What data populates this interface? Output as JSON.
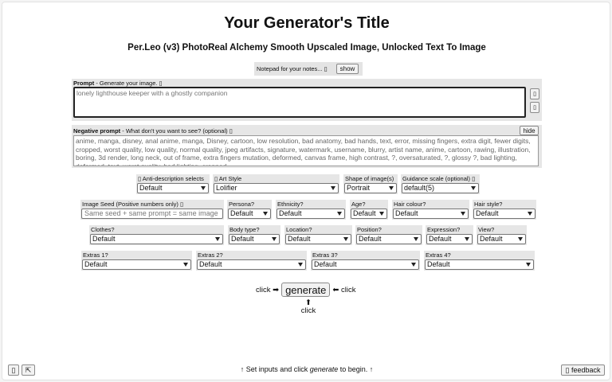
{
  "header": {
    "title": "Your Generator's Title",
    "subtitle": "Per.Leo (v3) PhotoReal Alchemy Smooth Upscaled Image, Unlocked Text To Image"
  },
  "notepad": {
    "label": "Notepad for your notes... ▯",
    "button": "show"
  },
  "prompt": {
    "label_bold": "Prompt",
    "label_rest": " - Generate your image. ▯",
    "placeholder": "lonely lighthouse keeper with a ghostly companion",
    "side_button_1": "▯",
    "side_button_2": "▯"
  },
  "negative_prompt": {
    "label_bold": "Negative prompt",
    "label_rest": " - What don't you want to see? (optional) ▯",
    "hide_button": "hide",
    "value": "anime, manga, disney, anal anime, manga, Disney, cartoon, low resolution, bad anatomy, bad hands, text, error, missing fingers, extra digit, fewer digits, cropped, worst quality, low quality, normal quality, jpeg artifacts, signature, watermark, username, blurry, artist name, anime, cartoon, rawing, illustration, boring, 3d render, long neck, out of frame, extra fingers mutation, deformed, canvas frame, high contrast, ?, oversaturated, ?, glossy ?, bad lighting, deformed, text, worst quality, bad lighting, cropped"
  },
  "row1": [
    {
      "label": "▯ Anti-description selects",
      "value": "Default"
    },
    {
      "label": "▯ Art Style",
      "value": "Lolifier"
    },
    {
      "label": "Shape of image(s)",
      "value": "Portrait"
    },
    {
      "label": "Guidance scale (optional) ▯",
      "value": "default(5)"
    }
  ],
  "row2": {
    "seed": {
      "label": "Image Seed (Positive numbers only) ▯",
      "placeholder": "Same seed + same prompt = same image"
    },
    "selects": [
      {
        "label": "Persona?",
        "value": "Default"
      },
      {
        "label": "Ethnicity?",
        "value": "Default"
      },
      {
        "label": "Age?",
        "value": "Default"
      },
      {
        "label": "Hair colour?",
        "value": "Default"
      },
      {
        "label": "Hair style?",
        "value": "Default"
      }
    ]
  },
  "row3": [
    {
      "label": "Clothes?",
      "value": "Default"
    },
    {
      "label": "Body type?",
      "value": "Default"
    },
    {
      "label": "Location?",
      "value": "Default"
    },
    {
      "label": "Position?",
      "value": "Default"
    },
    {
      "label": "Expression?",
      "value": "Default"
    },
    {
      "label": "View?",
      "value": "Default"
    }
  ],
  "row4": [
    {
      "label": "Extras 1?",
      "value": "Default"
    },
    {
      "label": "Extras 2?",
      "value": "Default"
    },
    {
      "label": "Extras 3?",
      "value": "Default"
    },
    {
      "label": "Extras 4?",
      "value": "Default"
    }
  ],
  "generate": {
    "left_hint": "click ➡",
    "button": "generate",
    "right_hint": "⬅ click",
    "below_arrow": "⬆",
    "below_hint": "click"
  },
  "footer": {
    "instruction_pre": "↑ Set inputs and click ",
    "instruction_em": "generate",
    "instruction_post": " to begin. ↑",
    "left_button_1": "▯",
    "left_button_2": "⇱",
    "feedback_button": "▯ feedback"
  }
}
